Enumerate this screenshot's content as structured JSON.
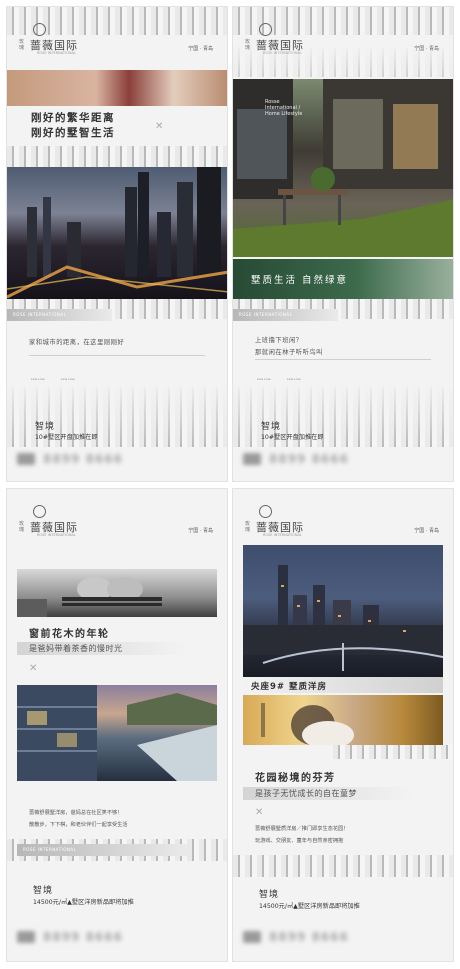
{
  "brand": {
    "name": "蔷薇国际",
    "side": "玫瑰",
    "en": "ROSE INTERNATIONAL"
  },
  "location": "宁国 · 青岛",
  "poster1": {
    "title_line1": "刚好的繁华距离",
    "title_line2": "刚好的墅智生活",
    "bar_text": "ROSE INTERNATIONAL",
    "body": "家和城市的距离，在这里刚刚好",
    "tags": [
      "Line Line",
      "Line Line"
    ],
    "zhijing": "智境",
    "price": "10#墅区开盘加推在即",
    "phone": "8899 8666"
  },
  "poster2": {
    "photo_caption": "Rosse International / Home Lifestyle",
    "banner": "墅质生活 自然绿意",
    "bar_text": "ROSE INTERNATIONAL",
    "body_line1": "上班撸下班闲？",
    "body_line2": "那就闲在林子听听鸟叫",
    "tags": [
      "Line Line",
      "Line Line"
    ],
    "zhijing": "智境",
    "price": "10#墅区开盘加推在即",
    "phone": "8899 8666"
  },
  "poster3": {
    "title": "窗前花木的年轮",
    "sub": "是爸妈带着茶香的慢时光",
    "body_line1": "蔷薇舒展墅洋房，爸妈总在社区笑不够！",
    "body_line2": "散散步，下下棋，和老伙伴们一起享受生活",
    "bar_text": "ROSE INTERNATIONAL",
    "zhijing": "智境",
    "price": "14500元/㎡▲墅区洋房新品即将加推",
    "phone": "8899 8666"
  },
  "poster4": {
    "caption": "央座9#  墅质洋房",
    "title": "花园秘境的芬芳",
    "sub": "是孩子无忧成长的自在童梦",
    "body_line1": "蔷薇舒展墅质洋房／推门即享生态花园！",
    "body_line2": "玩游戏、交朋友、童年与自然亲密拥抱",
    "zhijing": "智境",
    "price": "14500元/㎡▲墅区洋房新品即将加推",
    "phone": "8899 8666"
  }
}
